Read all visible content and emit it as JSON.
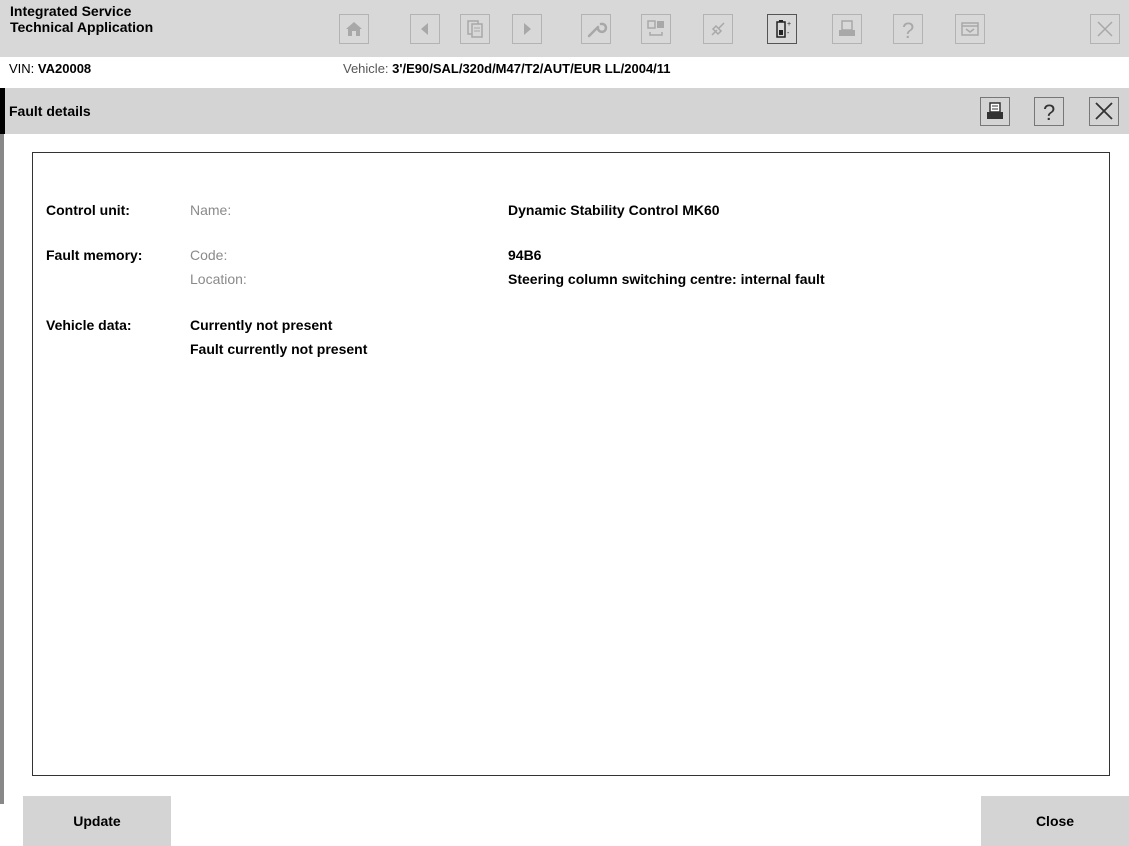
{
  "app": {
    "title_line1": "Integrated Service",
    "title_line2": "Technical Application"
  },
  "toolbar": {
    "icons": [
      "home-icon",
      "back-icon",
      "documents-icon",
      "forward-icon",
      "wrench-icon",
      "measure-icon",
      "connection-icon",
      "battery-icon",
      "print-icon",
      "help-icon",
      "menu-icon",
      "close-icon"
    ]
  },
  "vehicle_bar": {
    "vin_label": "VIN: ",
    "vin_value": "VA20008",
    "vehicle_label": "Vehicle: ",
    "vehicle_value": "3'/E90/SAL/320d/M47/T2/AUT/EUR LL/2004/11"
  },
  "dialog": {
    "title": "Fault details"
  },
  "details": {
    "control_unit_label": "Control unit:",
    "name_key": "Name:",
    "name_value": "Dynamic Stability Control MK60",
    "fault_memory_label": "Fault memory:",
    "code_key": "Code:",
    "code_value": "94B6",
    "location_key": "Location:",
    "location_value": "Steering column switching centre: internal fault",
    "vehicle_data_label": "Vehicle data:",
    "vehicle_data_line1": "Currently not present",
    "vehicle_data_line2": "Fault currently not present"
  },
  "buttons": {
    "update_label": "Update",
    "close_label": "Close"
  }
}
